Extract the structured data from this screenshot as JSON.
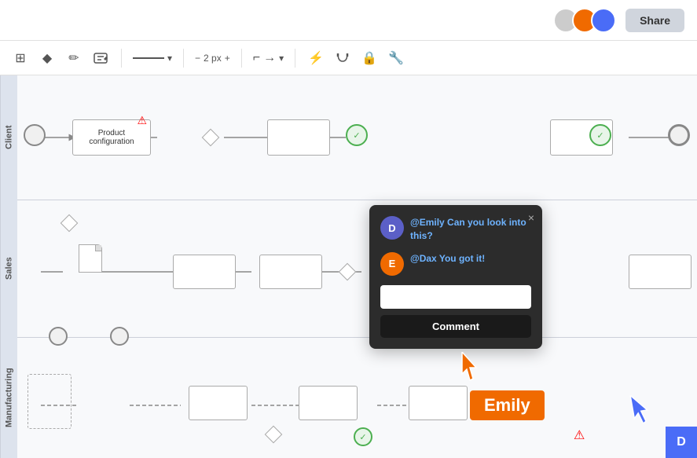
{
  "topbar": {
    "share_label": "Share"
  },
  "toolbar": {
    "px_label": "2 px",
    "minus_label": "−",
    "plus_label": "+"
  },
  "lanes": {
    "client": "Client",
    "sales": "Sales",
    "manufacturing": "Manufacturing"
  },
  "comment_popup": {
    "close_label": "×",
    "message1_user": "@Emily",
    "message1_text": " Can you look into this?",
    "message2_user": "@Dax",
    "message2_text": " You got it!",
    "input_placeholder": "",
    "submit_label": "Comment",
    "avatar1_letter": "D",
    "avatar2_letter": "E"
  },
  "emily_label": {
    "text": "Emily"
  },
  "blue_square": {
    "letter": "D"
  },
  "diagram": {
    "product_config_label": "Product\nconfiguration"
  }
}
